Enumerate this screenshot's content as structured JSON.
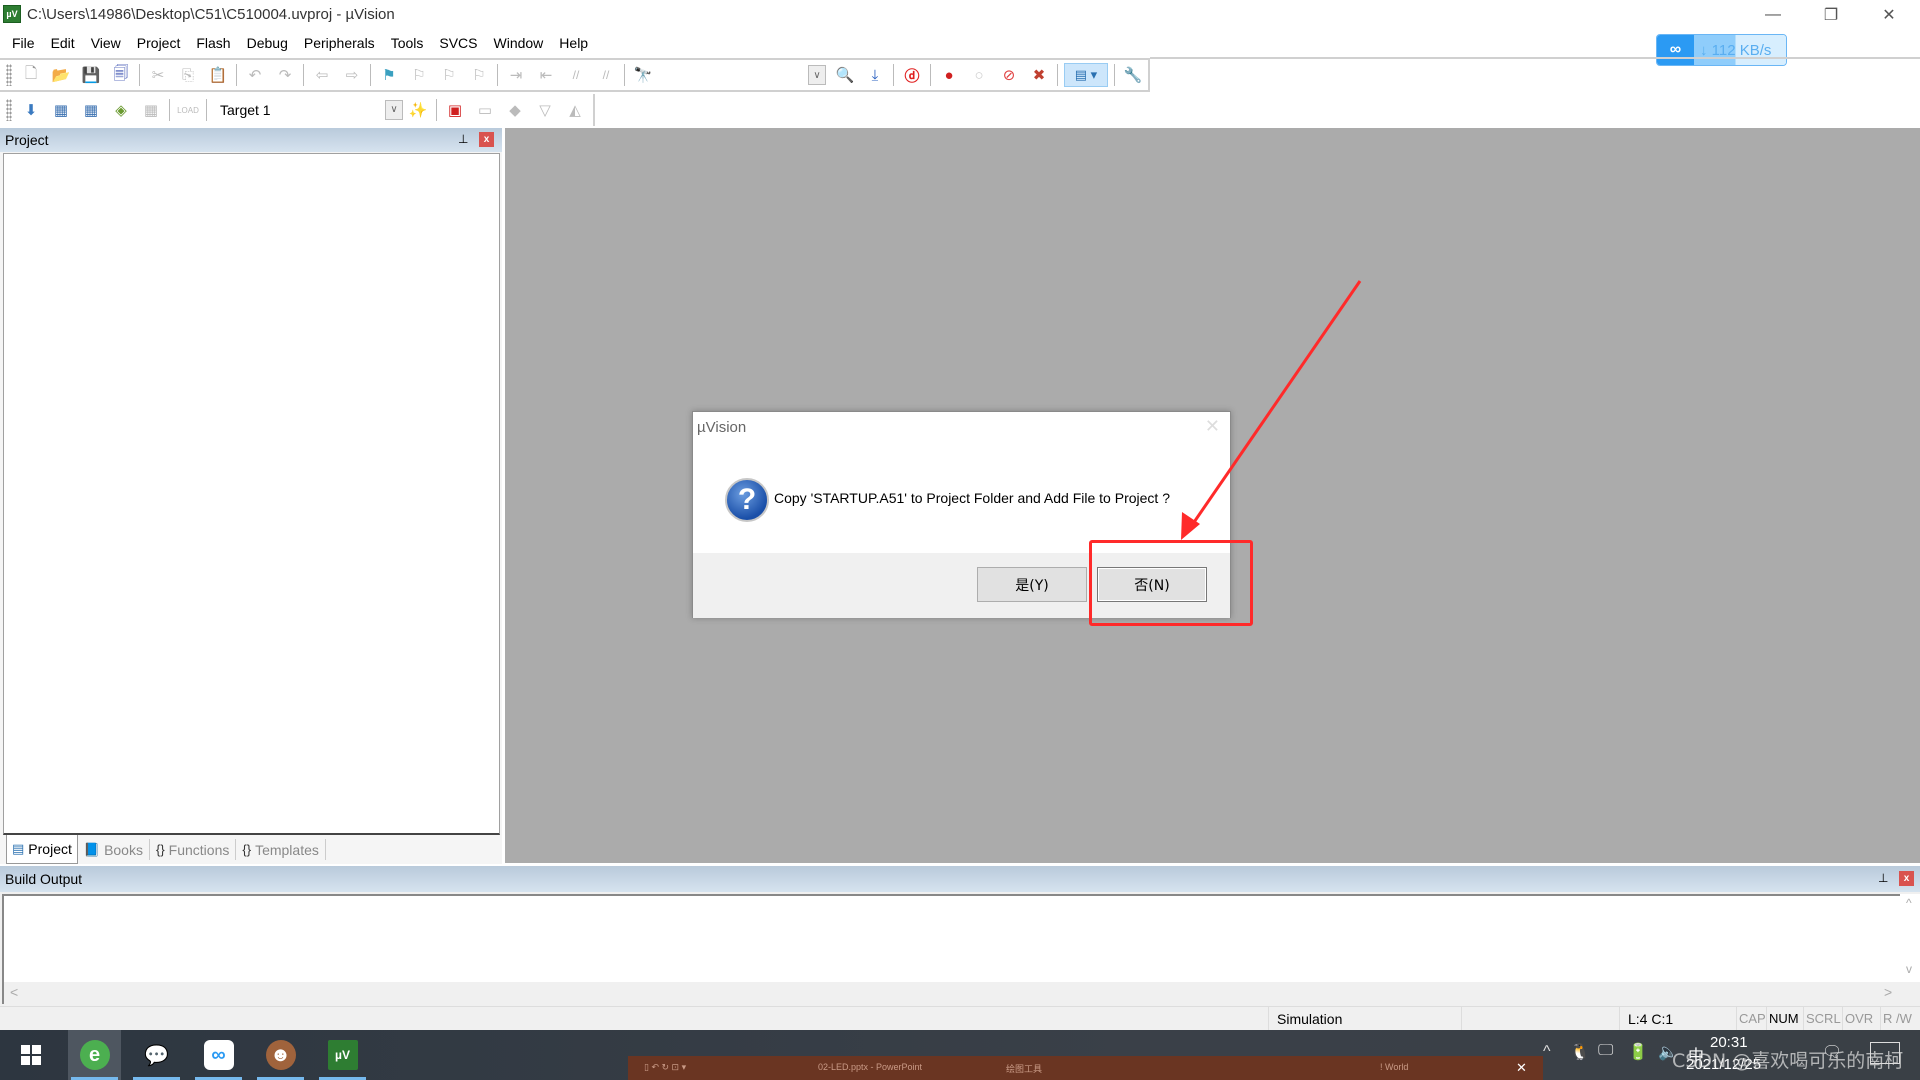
{
  "window": {
    "title": "C:\\Users\\14986\\Desktop\\C51\\C510004.uvproj - µVision",
    "app_icon": "µVision-icon",
    "controls": {
      "minimize": "—",
      "restore": "❐",
      "close": "✕"
    }
  },
  "menubar": {
    "items": [
      "File",
      "Edit",
      "View",
      "Project",
      "Flash",
      "Debug",
      "Peripherals",
      "Tools",
      "SVCS",
      "Window",
      "Help"
    ]
  },
  "net_badge": {
    "icon": "baidu-netdisk-icon",
    "speed": "↓ 112 KB/s"
  },
  "toolbar1": {
    "buttons": [
      {
        "name": "new-file",
        "glyph": "🗋"
      },
      {
        "name": "open-file",
        "glyph": "📂"
      },
      {
        "name": "save",
        "glyph": "💾"
      },
      {
        "name": "save-all",
        "glyph": "🗐"
      },
      {
        "name": "cut",
        "glyph": "✂"
      },
      {
        "name": "copy",
        "glyph": "⎘"
      },
      {
        "name": "paste",
        "glyph": "📋"
      },
      {
        "name": "undo",
        "glyph": "↶"
      },
      {
        "name": "redo",
        "glyph": "↷"
      },
      {
        "name": "navigate-back",
        "glyph": "⇦"
      },
      {
        "name": "navigate-forward",
        "glyph": "⇨"
      },
      {
        "name": "bookmark-toggle",
        "glyph": "⚑"
      },
      {
        "name": "bookmark-prev",
        "glyph": "⚐"
      },
      {
        "name": "bookmark-next",
        "glyph": "⚐"
      },
      {
        "name": "bookmark-clear",
        "glyph": "⚐"
      },
      {
        "name": "indent",
        "glyph": "⇥"
      },
      {
        "name": "unindent",
        "glyph": "⇤"
      },
      {
        "name": "comment",
        "glyph": "//"
      },
      {
        "name": "uncomment",
        "glyph": "//"
      },
      {
        "name": "find-in-files",
        "glyph": "🔭"
      }
    ],
    "right_buttons": [
      {
        "name": "find",
        "glyph": "🔍"
      },
      {
        "name": "incremental-find",
        "glyph": "⤓"
      },
      {
        "name": "debug-session",
        "glyph": "ⓓ"
      },
      {
        "name": "breakpoint-insert",
        "glyph": "●"
      },
      {
        "name": "breakpoint-enable",
        "glyph": "○"
      },
      {
        "name": "breakpoint-disable-all",
        "glyph": "⊘"
      },
      {
        "name": "breakpoint-kill-all",
        "glyph": "✖"
      },
      {
        "name": "window-layout",
        "glyph": "▤ ▾"
      },
      {
        "name": "configure",
        "glyph": "🔧"
      }
    ]
  },
  "toolbar2": {
    "buttons": [
      {
        "name": "translate",
        "glyph": "⬇"
      },
      {
        "name": "build",
        "glyph": "▦"
      },
      {
        "name": "rebuild",
        "glyph": "▦"
      },
      {
        "name": "batch-build",
        "glyph": "◈"
      },
      {
        "name": "stop-build",
        "glyph": "▦"
      },
      {
        "name": "download",
        "glyph": "LOAD"
      }
    ],
    "target": "Target 1",
    "right_buttons": [
      {
        "name": "options-for-target",
        "glyph": "✨"
      },
      {
        "name": "manage-components",
        "glyph": "▣"
      },
      {
        "name": "select-packs",
        "glyph": "▭"
      },
      {
        "name": "pack-installer",
        "glyph": "◆"
      },
      {
        "name": "software-packs",
        "glyph": "▽"
      },
      {
        "name": "manage-run-time",
        "glyph": "◭"
      }
    ]
  },
  "project_panel": {
    "title": "Project",
    "pin": "📌",
    "close": "x",
    "tabs": [
      {
        "label": "Project",
        "icon": "project-icon",
        "glyph": "▤",
        "active": true
      },
      {
        "label": "Books",
        "icon": "books-icon",
        "glyph": "📘",
        "active": false
      },
      {
        "label": "Functions",
        "icon": "functions-icon",
        "glyph": "{}",
        "active": false
      },
      {
        "label": "Templates",
        "icon": "templates-icon",
        "glyph": "{}",
        "active": false
      }
    ]
  },
  "build_output": {
    "title": "Build Output",
    "content": "",
    "scroll_up": "^",
    "scroll_down": "v",
    "scroll_left": "<",
    "scroll_right": ">"
  },
  "statusbar": {
    "mode": "Simulation",
    "position": "L:4 C:1",
    "flags": [
      {
        "label": "CAP",
        "on": false
      },
      {
        "label": "NUM",
        "on": true
      },
      {
        "label": "SCRL",
        "on": false
      },
      {
        "label": "OVR",
        "on": false
      },
      {
        "label": "R /W",
        "on": false
      }
    ]
  },
  "dialog": {
    "title": "µVision",
    "close": "✕",
    "icon": "question-icon",
    "icon_glyph": "?",
    "message": "Copy 'STARTUP.A51' to Project Folder and Add File to Project ?",
    "yes_label": "是(Y)",
    "no_label": "否(N)"
  },
  "annotation": {
    "color": "#ff2a2a",
    "target": "no-button"
  },
  "taskbar": {
    "apps": [
      {
        "name": "360-browser",
        "glyph": "e",
        "color": "#4caf50",
        "active": true
      },
      {
        "name": "wechat",
        "glyph": "💬",
        "color": "#3a4046",
        "active": false
      },
      {
        "name": "baidu-netdisk",
        "glyph": "∞",
        "color": "#ffffff",
        "active": false
      },
      {
        "name": "avatar-app",
        "glyph": "☻",
        "color": "#a0633c",
        "active": false
      },
      {
        "name": "keil-uvision",
        "glyph": "µV",
        "color": "#2e7d32",
        "active": false
      }
    ],
    "ppt_preview": {
      "filename": "02-LED.pptx - PowerPoint",
      "tool_label": "绘图工具",
      "right_label": "! World"
    },
    "tray": {
      "chevron": "^",
      "qq": "🐧",
      "network": "🖵",
      "battery": "🔋",
      "volume": "🔈",
      "ime": "中",
      "notification": "🗨"
    },
    "clock": {
      "time": "20:31",
      "date": "2021/12/25"
    }
  },
  "watermark": "CSDN @喜欢喝可乐的南柯"
}
